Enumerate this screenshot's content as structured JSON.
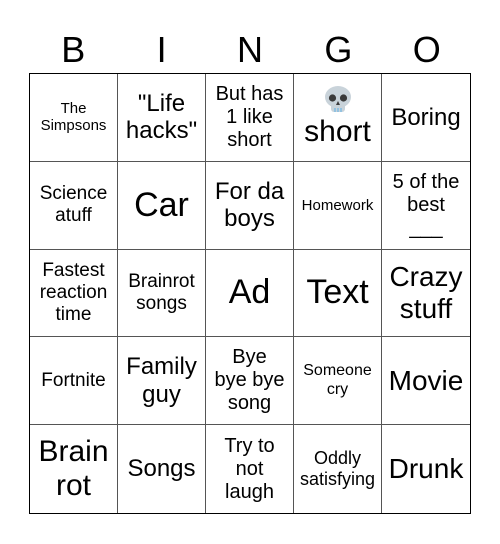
{
  "header": {
    "letters": [
      "B",
      "I",
      "N",
      "G",
      "O"
    ]
  },
  "board": {
    "rows": [
      [
        {
          "text": "The\nSimpsons"
        },
        {
          "text": "\"Life\nhacks\""
        },
        {
          "text": "But has\n1 like\nshort"
        },
        {
          "icon": "skull-emoji",
          "text": "short"
        },
        {
          "text": "Boring"
        }
      ],
      [
        {
          "text": "Science\natuff"
        },
        {
          "text": "Car"
        },
        {
          "text": "For da\nboys"
        },
        {
          "text": "Homework"
        },
        {
          "text": "5 of the\nbest\n___"
        }
      ],
      [
        {
          "text": "Fastest\nreaction\ntime"
        },
        {
          "text": "Brainrot\nsongs"
        },
        {
          "text": "Ad"
        },
        {
          "text": "Text"
        },
        {
          "text": "Crazy\nstuff"
        }
      ],
      [
        {
          "text": "Fortnite"
        },
        {
          "text": "Family\nguy"
        },
        {
          "text": "Bye\nbye bye\nsong"
        },
        {
          "text": "Someone\ncry"
        },
        {
          "text": "Movie"
        }
      ],
      [
        {
          "text": "Brain\nrot"
        },
        {
          "text": "Songs"
        },
        {
          "text": "Try to\nnot\nlaugh"
        },
        {
          "text": "Oddly\nsatisfying"
        },
        {
          "text": "Drunk"
        }
      ]
    ]
  }
}
